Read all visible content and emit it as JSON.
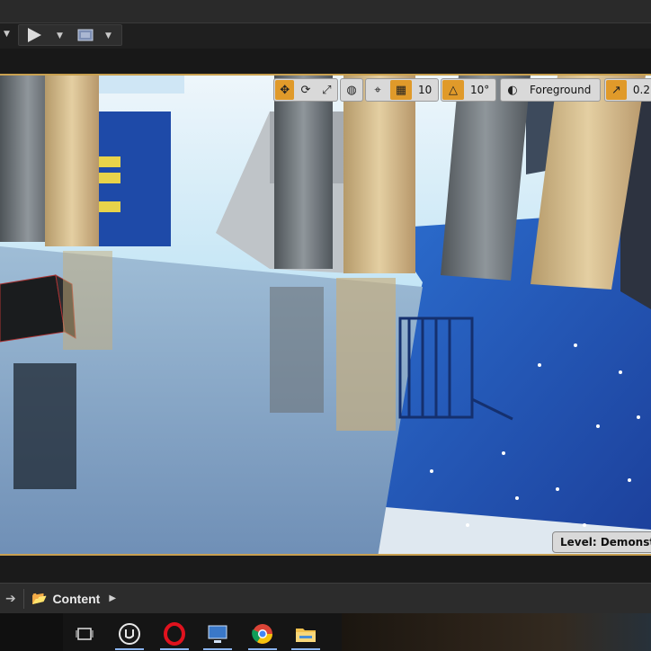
{
  "toolbar": {
    "play_icon": "play-icon",
    "launch_icon": "launch-icon",
    "dropdown_icon": "chevron-down-icon"
  },
  "viewport_toolbar": {
    "grid_snap_value": "10",
    "rotation_snap_value": "10°",
    "layer_value": "Foreground",
    "scale_snap_value": "0.2"
  },
  "level": {
    "label": "Level:  Demonstrati"
  },
  "content_browser": {
    "path_label": "Content"
  },
  "taskbar": {
    "items": [
      "task-view-icon",
      "unreal-engine-icon",
      "opera-icon",
      "remote-desktop-icon",
      "chrome-icon",
      "file-explorer-icon"
    ]
  },
  "colors": {
    "accent": "#e09a2a",
    "viewport_border": "#c8a050",
    "sky": "#9fd8f2",
    "floor": "#7fa2c8"
  }
}
